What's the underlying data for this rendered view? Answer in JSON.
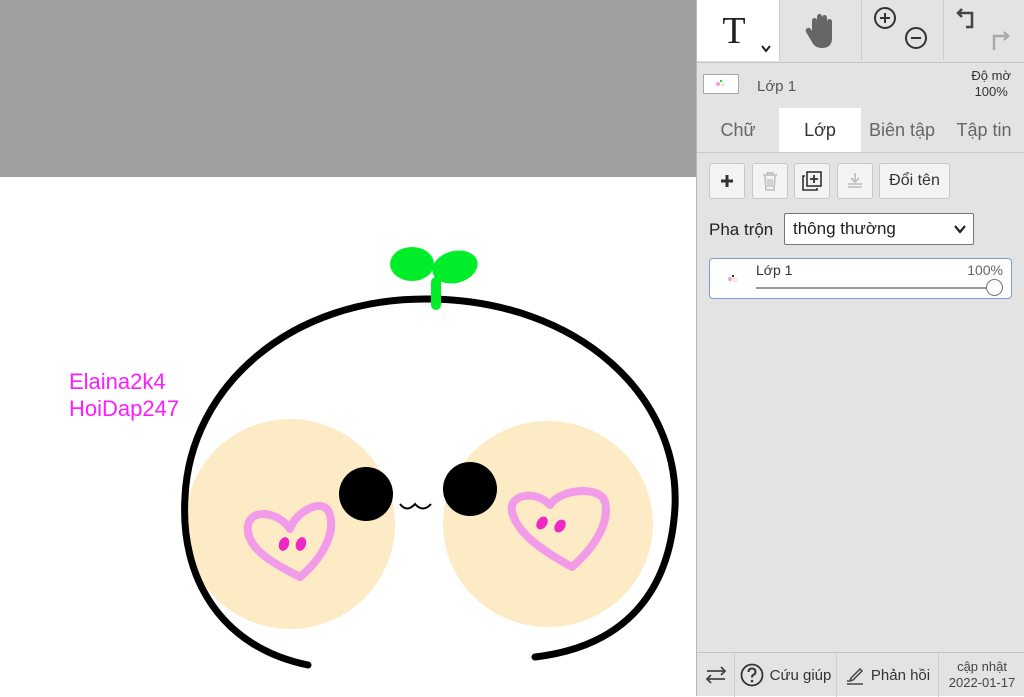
{
  "canvas": {
    "text_lines": [
      "Elaina2k4",
      "HoiDap247"
    ],
    "text_color": "#ff1dff"
  },
  "toolbar": {
    "text_tool_glyph": "T",
    "tools": [
      "text-tool",
      "hand-tool",
      "zoom-tool",
      "undo-redo"
    ]
  },
  "layer_info": {
    "name": "Lớp 1",
    "opacity_title": "Độ mờ",
    "opacity_value": "100%"
  },
  "tabs": [
    {
      "label": "Chữ",
      "active": false
    },
    {
      "label": "Lớp",
      "active": true
    },
    {
      "label": "Biên tập",
      "active": false
    },
    {
      "label": "Tập tin",
      "active": false
    }
  ],
  "layer_tools": {
    "rename_label": "Đổi tên"
  },
  "blend": {
    "label": "Pha trộn",
    "value": "thông thường"
  },
  "layer_list": [
    {
      "name": "Lớp 1",
      "opacity": "100%",
      "opacity_fraction": 1.0
    }
  ],
  "footer": {
    "help_label": "Cứu giúp",
    "feedback_label": "Phản hồi",
    "updated_label": "cập nhật",
    "updated_date": "2022-01-17"
  }
}
